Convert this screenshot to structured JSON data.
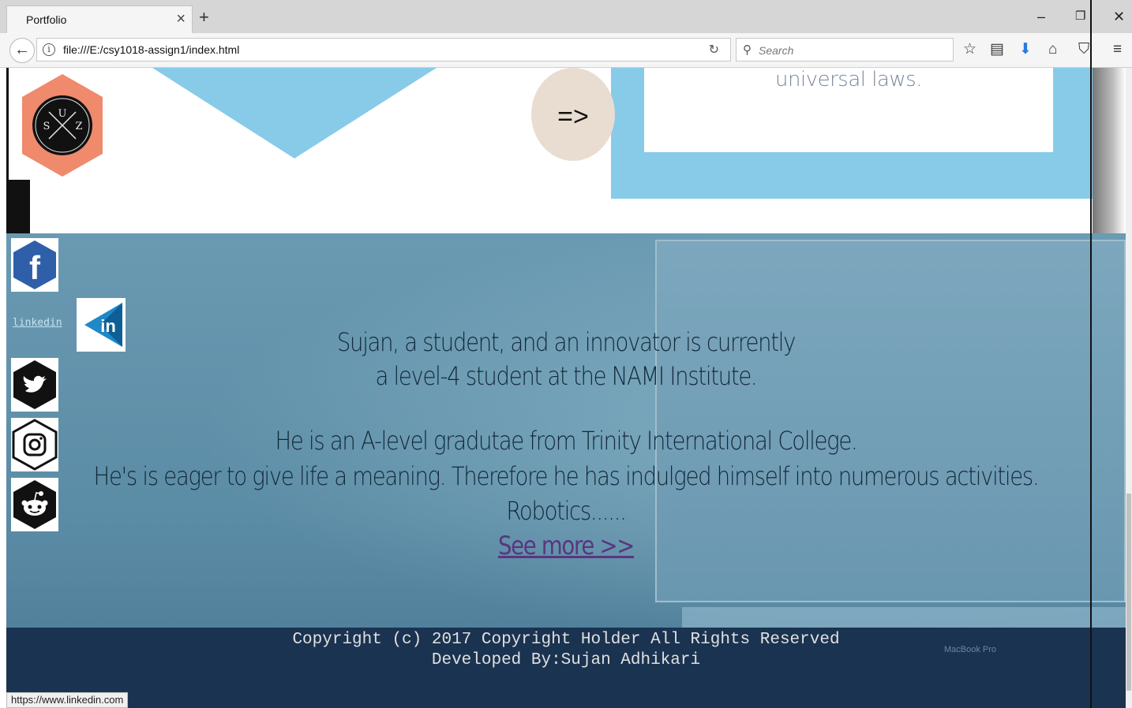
{
  "browser": {
    "tab_title": "Portfolio",
    "url": "file:///E:/csy1018-assign1/index.html",
    "search_placeholder": "Search",
    "status_url": "https://www.linkedin.com"
  },
  "top_section": {
    "logo_letters": {
      "top": "U",
      "left": "S",
      "right": "Z"
    },
    "arrow_label": "=>",
    "right_box_text": "universal laws."
  },
  "social": {
    "linkedin_label": "linkedin"
  },
  "hero": {
    "line1": "Sujan, a student, and an innovator is currently",
    "line2": "a level-4 student at the NAMI Institute.",
    "line3": "He is an A-level gradutae from Trinity International College.",
    "line4": "He's is eager to give life a meaning. Therefore he has indulged himself into numerous activities.",
    "line5": "Robotics......",
    "see_more": "See more >>"
  },
  "footer": {
    "copyright": "Copyright (c) 2017 Copyright Holder All Rights Reserved",
    "developer": "Developed By:Sujan Adhikari",
    "macbook_label": "MacBook Pro"
  },
  "colors": {
    "sky_blue": "#87cbe8",
    "logo_orange": "#ef8a6c",
    "hero_blue": "#5d8ea7",
    "footer_navy": "#1a3350"
  }
}
